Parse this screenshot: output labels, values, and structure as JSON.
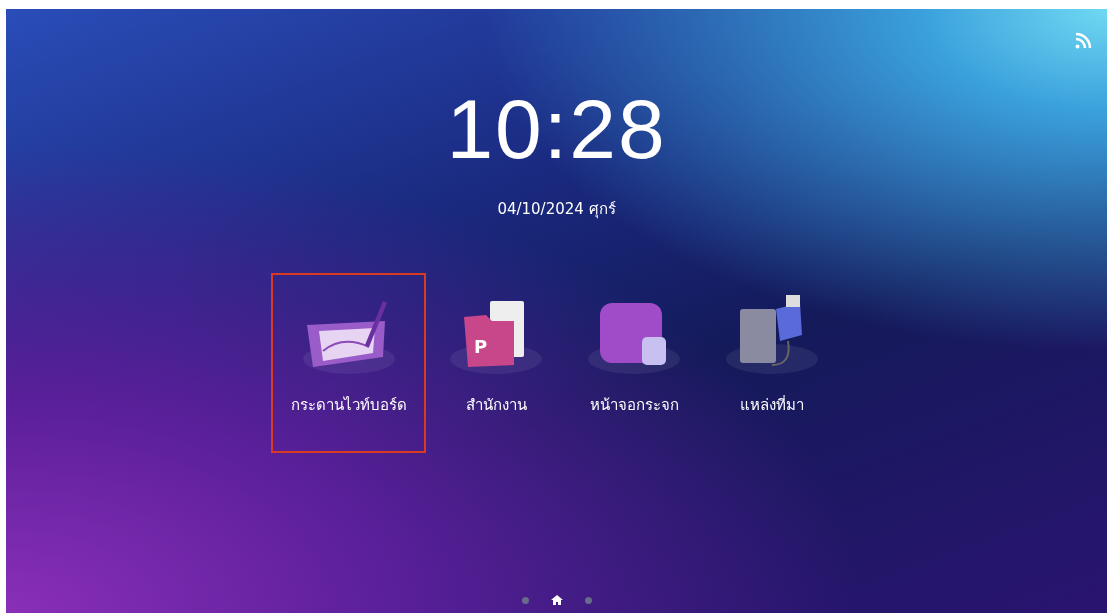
{
  "clock": {
    "time": "10:28",
    "date": "04/10/2024 ศุกร์"
  },
  "apps": [
    {
      "kind": "whiteboard",
      "label": "กระดานไวท์บอร์ด",
      "selected": true
    },
    {
      "kind": "office",
      "label": "สำนักงาน",
      "selected": false,
      "badge": "P"
    },
    {
      "kind": "mirror",
      "label": "หน้าจอกระจก",
      "selected": false
    },
    {
      "kind": "source",
      "label": "แหล่งที่มา",
      "selected": false
    }
  ],
  "pager": [
    {
      "kind": "dot",
      "selected": false
    },
    {
      "kind": "home",
      "selected": true
    },
    {
      "kind": "dot",
      "selected": false
    }
  ]
}
